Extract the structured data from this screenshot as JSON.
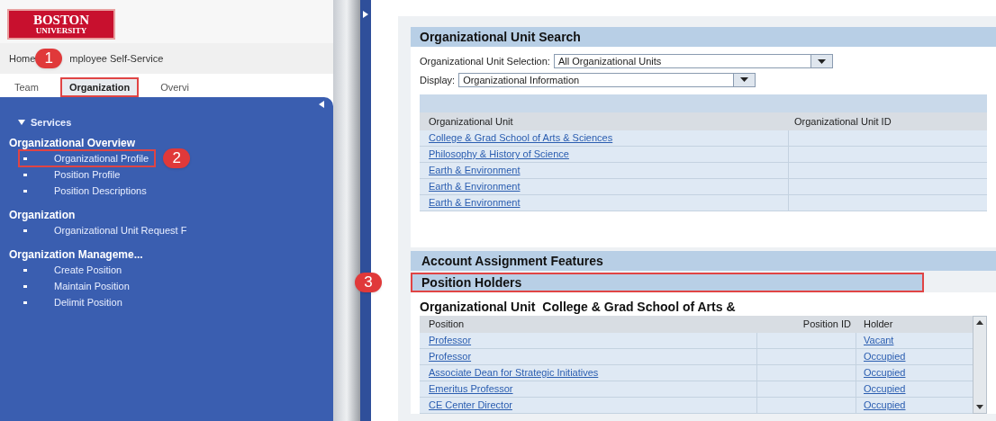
{
  "logo": {
    "line1": "BOSTON",
    "line2": "UNIVERSITY"
  },
  "top_nav": [
    {
      "label": "Home"
    },
    {
      "label": "mployee Self-Service",
      "callout": "1"
    }
  ],
  "tabs": [
    {
      "label": "Team",
      "selected": false,
      "annotated": false
    },
    {
      "label": "Organization",
      "selected": true,
      "annotated": true
    },
    {
      "label": "Overvi",
      "selected": false,
      "annotated": false
    }
  ],
  "sidebar": {
    "items": [
      {
        "kind": "toggle",
        "label": "Services",
        "expanded": true
      },
      {
        "kind": "group",
        "label": "Organizational Overview"
      },
      {
        "kind": "link",
        "label": "Organizational Profile",
        "annotated": true,
        "callout": "2"
      },
      {
        "kind": "link",
        "label": "Position Profile",
        "annotated": false
      },
      {
        "kind": "link",
        "label": "Position Descriptions",
        "annotated": false
      },
      {
        "kind": "group",
        "label": "Organization"
      },
      {
        "kind": "link",
        "label": "Organizational Unit Request F",
        "annotated": false
      },
      {
        "kind": "group",
        "label": "Organization Manageme..."
      },
      {
        "kind": "link",
        "label": "Create Position",
        "annotated": false
      },
      {
        "kind": "link",
        "label": "Maintain Position",
        "annotated": false
      },
      {
        "kind": "link",
        "label": "Delimit Position",
        "annotated": false
      }
    ]
  },
  "search": {
    "title": "Organizational Unit Search",
    "selection": {
      "label": "Organizational Unit Selection:",
      "value": "All Organizational Units"
    },
    "display": {
      "label": "Display:",
      "value": "Organizational Information"
    },
    "table": {
      "columns": [
        "Organizational Unit",
        "Organizational Unit ID"
      ],
      "rows": [
        {
          "unit": "College & Grad School of Arts & Sciences"
        },
        {
          "unit": "Philosophy & History of Science"
        },
        {
          "unit": "Earth & Environment"
        },
        {
          "unit": "Earth & Environment"
        },
        {
          "unit": "Earth & Environment"
        }
      ]
    }
  },
  "sections": [
    {
      "title": "Account Assignment Features",
      "annotated": false
    },
    {
      "title": "Position Holders",
      "annotated": true,
      "callout": "3"
    }
  ],
  "holders": {
    "caption_label": "Organizational Unit",
    "caption_value": "College & Grad School of Arts &",
    "columns": [
      "Position",
      "Position ID",
      "Holder"
    ],
    "rows": [
      {
        "position": "Professor",
        "holder": "Vacant"
      },
      {
        "position": "Professor",
        "holder": "Occupied"
      },
      {
        "position": "Associate Dean for Strategic Initiatives",
        "holder": "Occupied"
      },
      {
        "position": "Emeritus Professor",
        "holder": "Occupied"
      },
      {
        "position": "CE Center Director",
        "holder": "Occupied"
      }
    ]
  }
}
